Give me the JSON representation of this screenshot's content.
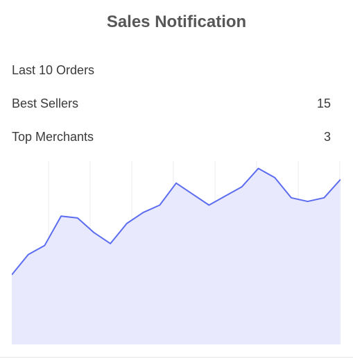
{
  "widget": {
    "title": "Sales Notification",
    "stats": [
      {
        "label": "Last 10 Orders",
        "value": ""
      },
      {
        "label": "Best Sellers",
        "value": "15"
      },
      {
        "label": "Top Merchants",
        "value": "3"
      }
    ]
  },
  "colors": {
    "line": "#5b6cf0",
    "fill": "#e8e9fc",
    "grid": "#ececef"
  },
  "chart_data": {
    "type": "area",
    "x": [
      0,
      1,
      2,
      3,
      4,
      5,
      6,
      7,
      8,
      9,
      10,
      11,
      12,
      13,
      14,
      15,
      16,
      17,
      18,
      19,
      20,
      21,
      22,
      23
    ],
    "values": [
      38,
      49,
      54,
      70,
      69,
      61,
      55,
      66,
      72,
      76,
      88,
      82,
      76,
      81,
      86,
      96,
      91,
      80,
      78,
      80,
      90
    ],
    "ylim": [
      0,
      100
    ],
    "grid": true
  }
}
